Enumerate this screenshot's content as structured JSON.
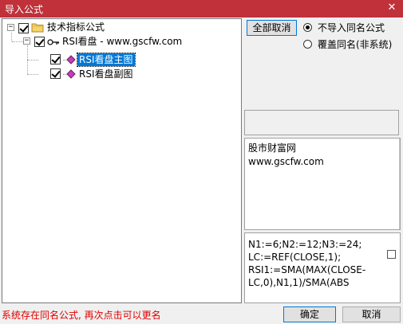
{
  "window": {
    "title": "导入公式",
    "close_glyph": "✕"
  },
  "tree": {
    "root": {
      "label": "技术指标公式",
      "expander": "−"
    },
    "group": {
      "label": "RSI看盘 - www.gscfw.com",
      "expander": "−"
    },
    "items": [
      {
        "label": "RSI看盘主图",
        "selected": true
      },
      {
        "label": "RSI看盘副图",
        "selected": false
      }
    ]
  },
  "options": {
    "deselect_all_label": "全部取消",
    "radios": [
      {
        "label": "不导入同名公式",
        "checked": true
      },
      {
        "label": "覆盖同名(非系统)",
        "checked": false
      }
    ]
  },
  "description": {
    "lines": "股市财富网\nwww.gscfw.com"
  },
  "formula": {
    "text": "N1:=6;N2:=12;N3:=24;\nLC:=REF(CLOSE,1);\nRSI1:=SMA(MAX(CLOSE-\nLC,0),N1,1)/SMA(ABS"
  },
  "status": {
    "message": "系统存在同名公式, 再次点击可以更名"
  },
  "footer": {
    "ok_label": "确定",
    "cancel_label": "取消"
  }
}
